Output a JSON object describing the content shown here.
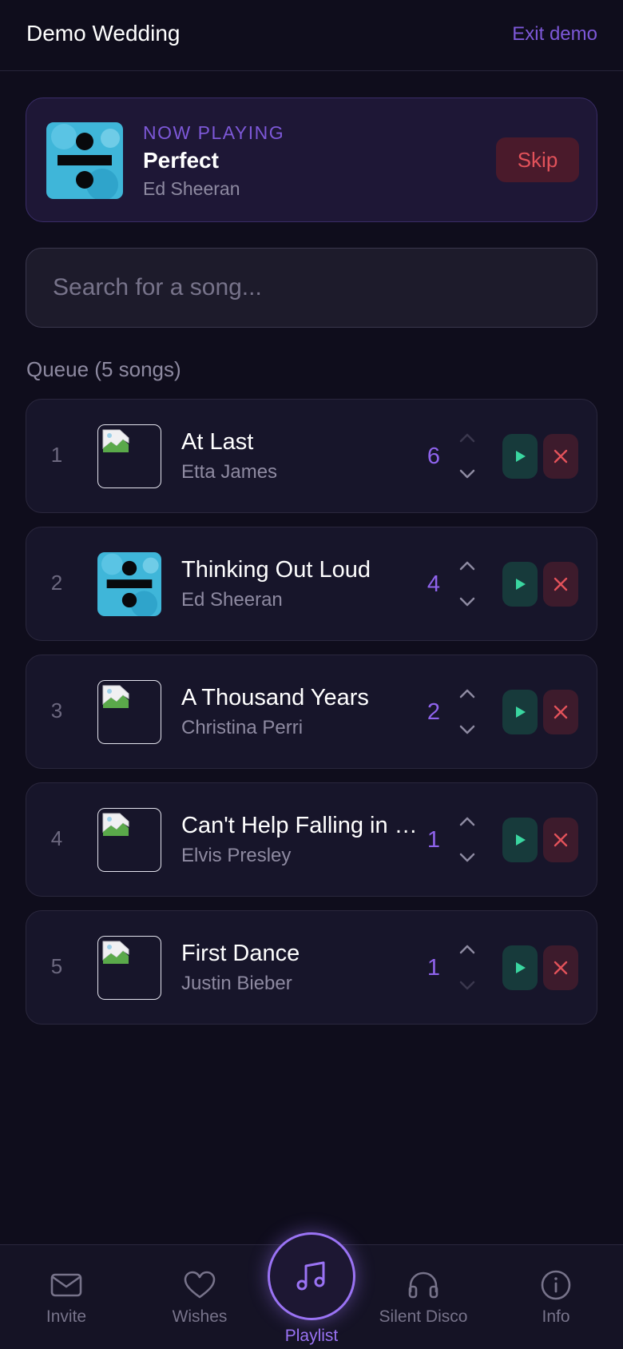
{
  "header": {
    "title": "Demo Wedding",
    "exit_label": "Exit demo"
  },
  "now_playing": {
    "label": "NOW PLAYING",
    "title": "Perfect",
    "artist": "Ed Sheeran",
    "art_icon": "divide-album-art",
    "skip_label": "Skip"
  },
  "search": {
    "placeholder": "Search for a song..."
  },
  "queue": {
    "title": "Queue (5 songs)",
    "items": [
      {
        "position": "1",
        "title": "At Last",
        "artist": "Etta James",
        "votes": "6",
        "art": "broken-image"
      },
      {
        "position": "2",
        "title": "Thinking Out Loud",
        "artist": "Ed Sheeran",
        "votes": "4",
        "art": "divide-album-art"
      },
      {
        "position": "3",
        "title": "A Thousand Years",
        "artist": "Christina Perri",
        "votes": "2",
        "art": "broken-image"
      },
      {
        "position": "4",
        "title": "Can't Help Falling in Love",
        "artist": "Elvis Presley",
        "votes": "1",
        "art": "broken-image"
      },
      {
        "position": "5",
        "title": "First Dance",
        "artist": "Justin Bieber",
        "votes": "1",
        "art": "broken-image"
      }
    ]
  },
  "nav": {
    "invite": "Invite",
    "wishes": "Wishes",
    "playlist": "Playlist",
    "silent_disco": "Silent Disco",
    "info": "Info"
  },
  "colors": {
    "background": "#0f0d1c",
    "accent": "#9a73f4",
    "play": "#3ad6a0",
    "danger": "#e2525a"
  }
}
